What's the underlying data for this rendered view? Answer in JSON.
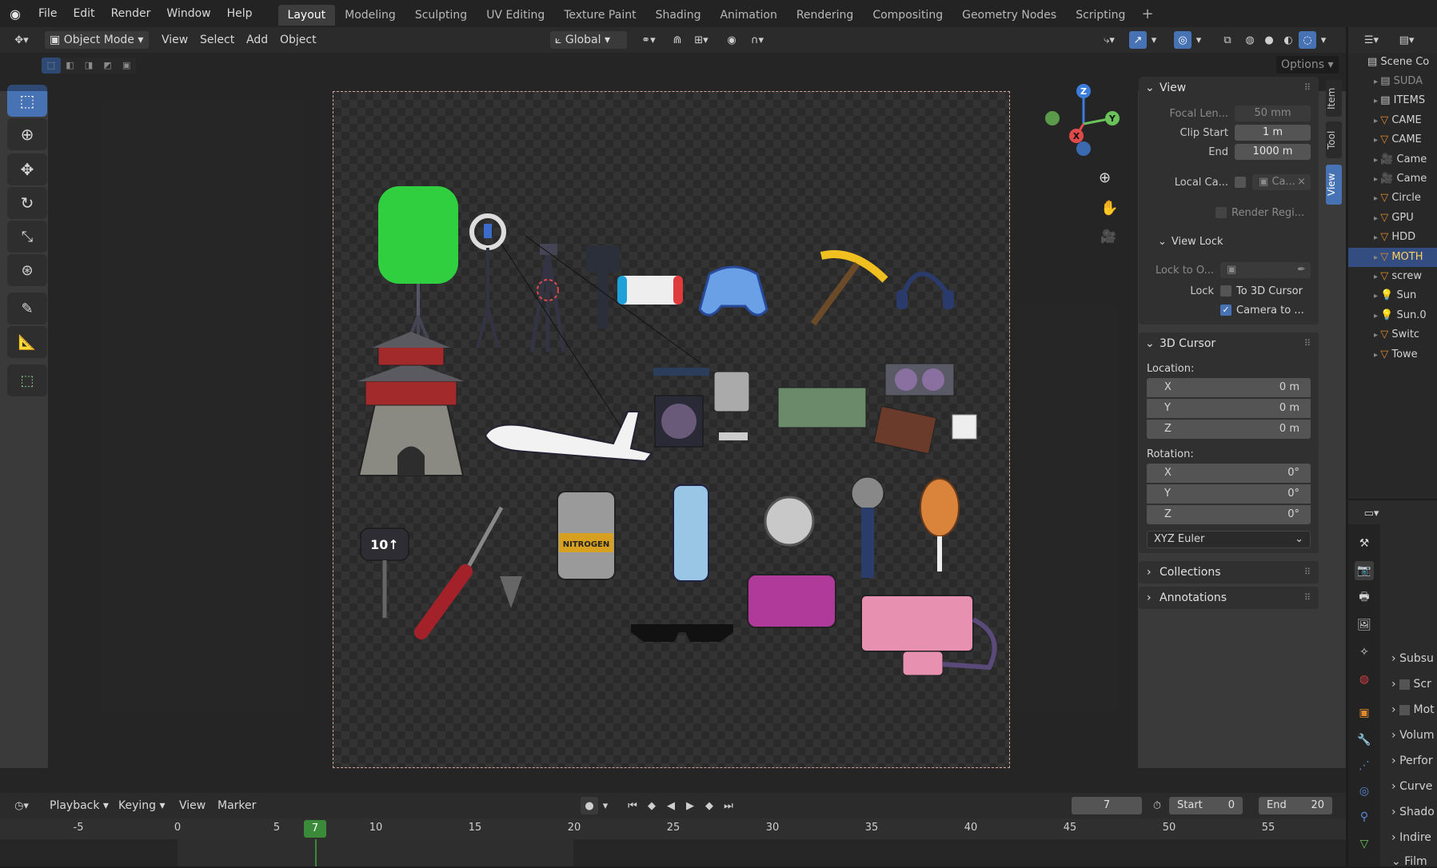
{
  "menu": [
    "File",
    "Edit",
    "Render",
    "Window",
    "Help"
  ],
  "workspaces": [
    "Layout",
    "Modeling",
    "Sculpting",
    "UV Editing",
    "Texture Paint",
    "Shading",
    "Animation",
    "Rendering",
    "Compositing",
    "Geometry Nodes",
    "Scripting"
  ],
  "active_workspace": "Layout",
  "header": {
    "mode": "Object Mode",
    "view": "View",
    "select": "Select",
    "add": "Add",
    "object": "Object",
    "transform": "Global",
    "options": "Options"
  },
  "viewport_labels": {
    "sign": "10↑",
    "canister": "NITROGEN"
  },
  "gizmo": {
    "z": "Z",
    "x": "X",
    "y": "Y"
  },
  "sidebar": {
    "tabs": [
      "Item",
      "Tool",
      "View"
    ],
    "view_panel": {
      "title": "View",
      "focal_label": "Focal Len...",
      "focal_value": "50 mm",
      "clip_start_label": "Clip Start",
      "clip_start_value": "1 m",
      "end_label": "End",
      "end_value": "1000 m",
      "local_camera_label": "Local Ca...",
      "local_camera_value": "Ca...",
      "render_region": "Render Regi..."
    },
    "view_lock": {
      "title": "View Lock",
      "lock_to_label": "Lock to O...",
      "lock_label": "Lock",
      "to_3d_cursor": "To 3D Cursor",
      "camera_to": "Camera to ..."
    },
    "cursor_panel": {
      "title": "3D Cursor",
      "location_label": "Location:",
      "loc": [
        {
          "axis": "X",
          "value": "0 m"
        },
        {
          "axis": "Y",
          "value": "0 m"
        },
        {
          "axis": "Z",
          "value": "0 m"
        }
      ],
      "rotation_label": "Rotation:",
      "rot": [
        {
          "axis": "X",
          "value": "0°"
        },
        {
          "axis": "Y",
          "value": "0°"
        },
        {
          "axis": "Z",
          "value": "0°"
        }
      ],
      "rotation_mode": "XYZ Euler"
    },
    "collections": "Collections",
    "annotations": "Annotations"
  },
  "outliner": {
    "root": "Scene Co",
    "items": [
      "SUDA",
      "ITEMS",
      "CAME",
      "CAME",
      "Came",
      "Came",
      "Circle",
      "GPU",
      "HDD",
      "MOTH",
      "screw",
      "Sun",
      "Sun.0",
      "Switc",
      "Towe"
    ],
    "selected_index": 9
  },
  "properties": {
    "items": [
      "Subsu",
      "Scr",
      "Mot",
      "Volum",
      "Perfor",
      "Curve",
      "Shado",
      "Indire",
      "Film"
    ]
  },
  "timeline": {
    "playback": "Playback",
    "keying": "Keying",
    "view": "View",
    "marker": "Marker",
    "current_frame": "7",
    "start_label": "Start",
    "start_value": "0",
    "end_label": "End",
    "end_value": "20",
    "ticks": [
      "-5",
      "0",
      "5",
      "10",
      "15",
      "20",
      "25",
      "30",
      "35",
      "40",
      "45",
      "50",
      "55"
    ],
    "playhead": "7"
  }
}
